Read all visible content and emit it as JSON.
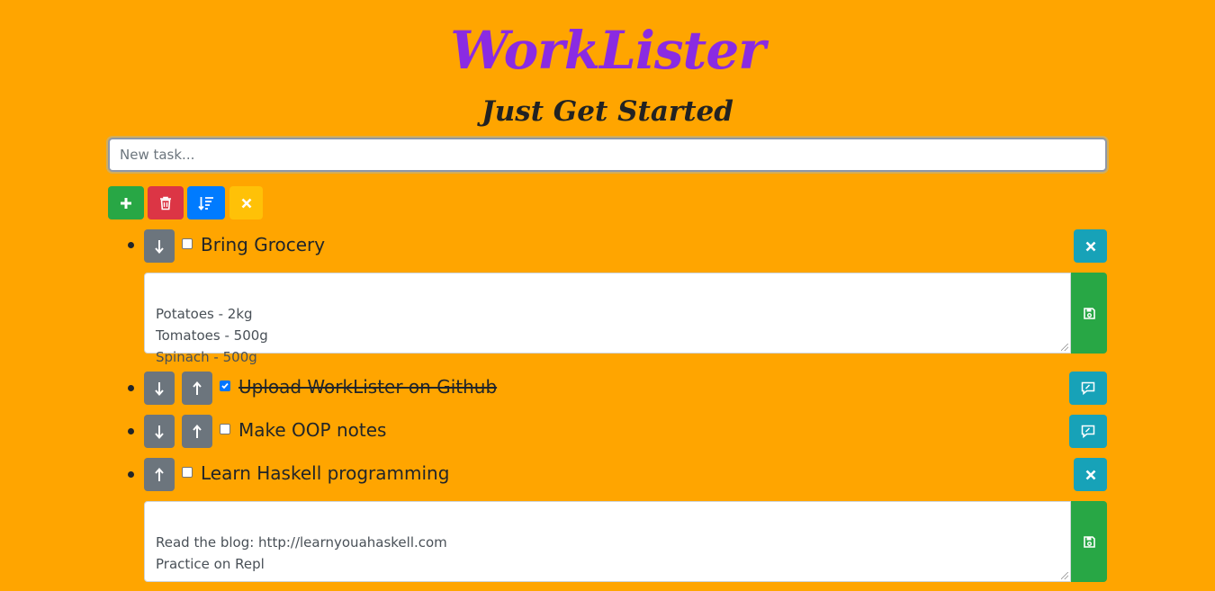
{
  "header": {
    "title": "WorkLister",
    "subtitle": "Just Get Started"
  },
  "new_task": {
    "placeholder": "New task..."
  },
  "toolbar": {
    "add_icon": "plus-icon",
    "delete_icon": "trash-icon",
    "sort_icon": "sort-icon",
    "clear_icon": "close-icon"
  },
  "tasks": [
    {
      "label": "Bring Grocery",
      "checked": false,
      "note": "Potatoes - 2kg\nTomatoes - 500g\nSpinach - 500g"
    },
    {
      "label": "Upload WorkLister on Github",
      "checked": true
    },
    {
      "label": "Make OOP notes",
      "checked": false
    },
    {
      "label": "Learn Haskell programming",
      "checked": false,
      "note": "Read the blog: http://learnyouahaskell.com\nPractice on Repl"
    }
  ],
  "colors": {
    "background": "#ffa500",
    "title": "#8a2be2",
    "success": "#28a745",
    "danger": "#dc3545",
    "primary": "#007bff",
    "warning": "#ffc107",
    "secondary": "#6c757d",
    "info": "#17a2b8"
  }
}
